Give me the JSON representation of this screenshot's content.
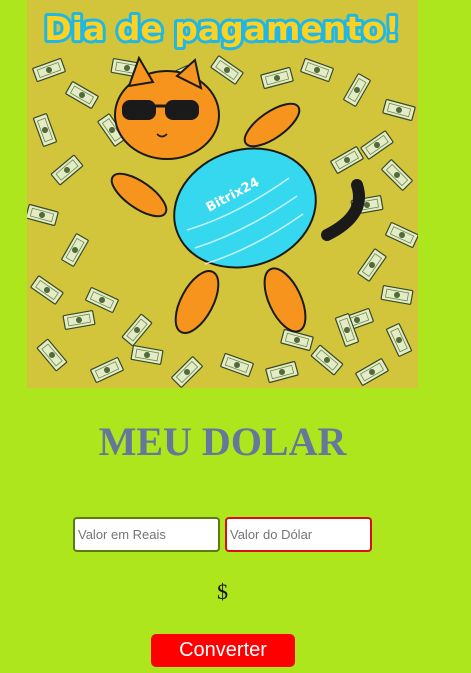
{
  "hero": {
    "banner_text": "Dia de pagamento!",
    "shirt_text": "Bitrix24",
    "colors": {
      "background": "#d3c53b",
      "cat": "#f7941d",
      "shirt": "#36d8f0",
      "banner_fill": "#ffd21f",
      "banner_outline": "#1fb7e6"
    }
  },
  "title": "MEU DOLAR",
  "form": {
    "reais_placeholder": "Valor em Reais",
    "dolar_placeholder": "Valor do Dólar"
  },
  "result": "$",
  "button": {
    "label": "Converter"
  },
  "colors": {
    "page_background": "#ade61c",
    "title": "#65789a",
    "button": "#ff0000",
    "reais_border": "#5e7a14",
    "dolar_border": "#d90f0f"
  }
}
